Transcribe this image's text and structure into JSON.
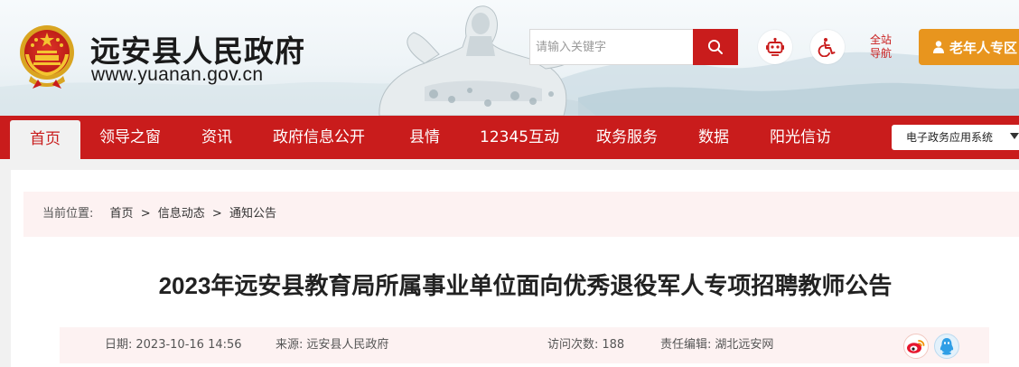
{
  "header": {
    "site_name": "远安县人民政府",
    "site_url": "www.yuanan.gov.cn",
    "search_placeholder": "请输入关键字",
    "nav_guide_line1": "全站",
    "nav_guide_line2": "导航",
    "elder_label": "老年人专区"
  },
  "nav": {
    "items": [
      "首页",
      "领导之窗",
      "资讯",
      "政府信息公开",
      "县情",
      "12345互动",
      "政务服务",
      "数据",
      "阳光信访"
    ],
    "system_select": "电子政务应用系统"
  },
  "breadcrumb": {
    "prefix": "当前位置:",
    "items": [
      "首页",
      "信息动态",
      "通知公告"
    ],
    "sep": ">"
  },
  "article": {
    "title": "2023年远安县教育局所属事业单位面向优秀退役军人专项招聘教师公告",
    "date_label": "日期:",
    "date": "2023-10-16 14:56",
    "source_label": "来源:",
    "source": "远安县人民政府",
    "views_label": "访问次数:",
    "views": "188",
    "editor_label": "责任编辑:",
    "editor": "湖北远安网"
  },
  "colors": {
    "brand_red": "#c91c1c",
    "elder_orange": "#e8951e",
    "crumb_bg": "#fdf2f2"
  },
  "icons": [
    "search-icon",
    "robot-icon",
    "accessibility-icon",
    "user-icon",
    "weibo-icon",
    "qq-icon",
    "chevron-down-icon",
    "national-emblem-icon"
  ]
}
